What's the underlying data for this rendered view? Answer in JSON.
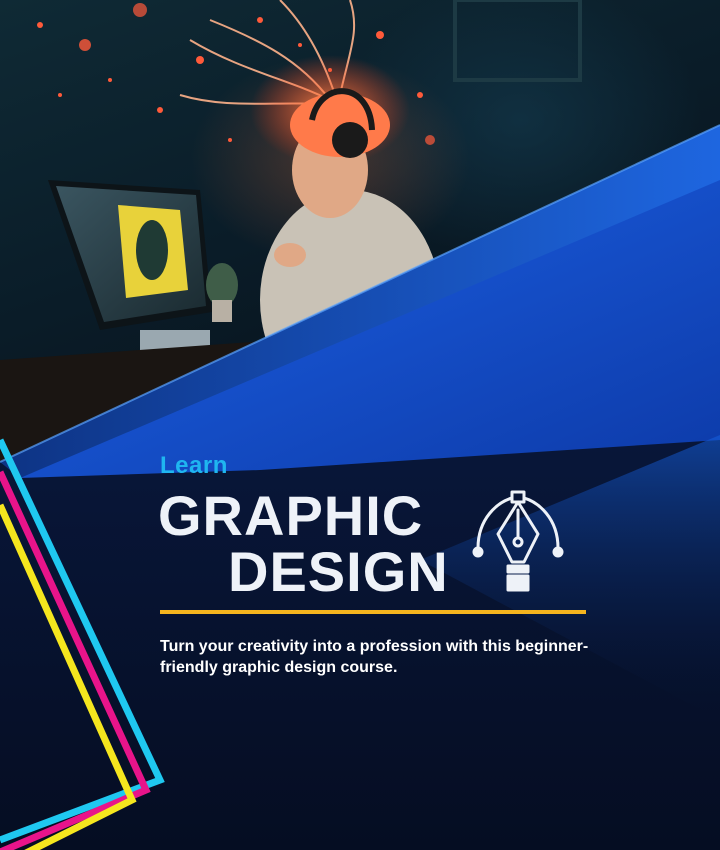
{
  "hero": {
    "learn": "Learn",
    "title_line1": "GRAPHIC",
    "title_line2": "DESIGN",
    "description": "Turn your creativity into a profession with this beginner-friendly graphic design course."
  },
  "icons": {
    "pen_tool": "pen-tool-icon"
  },
  "colors": {
    "background_navy": "#081638",
    "panel_blue": "#1560e0",
    "accent_cyan": "#1fb6f0",
    "accent_yellow": "#f5b41e",
    "accent_magenta": "#e8148a",
    "title_white": "#eef2f8"
  }
}
